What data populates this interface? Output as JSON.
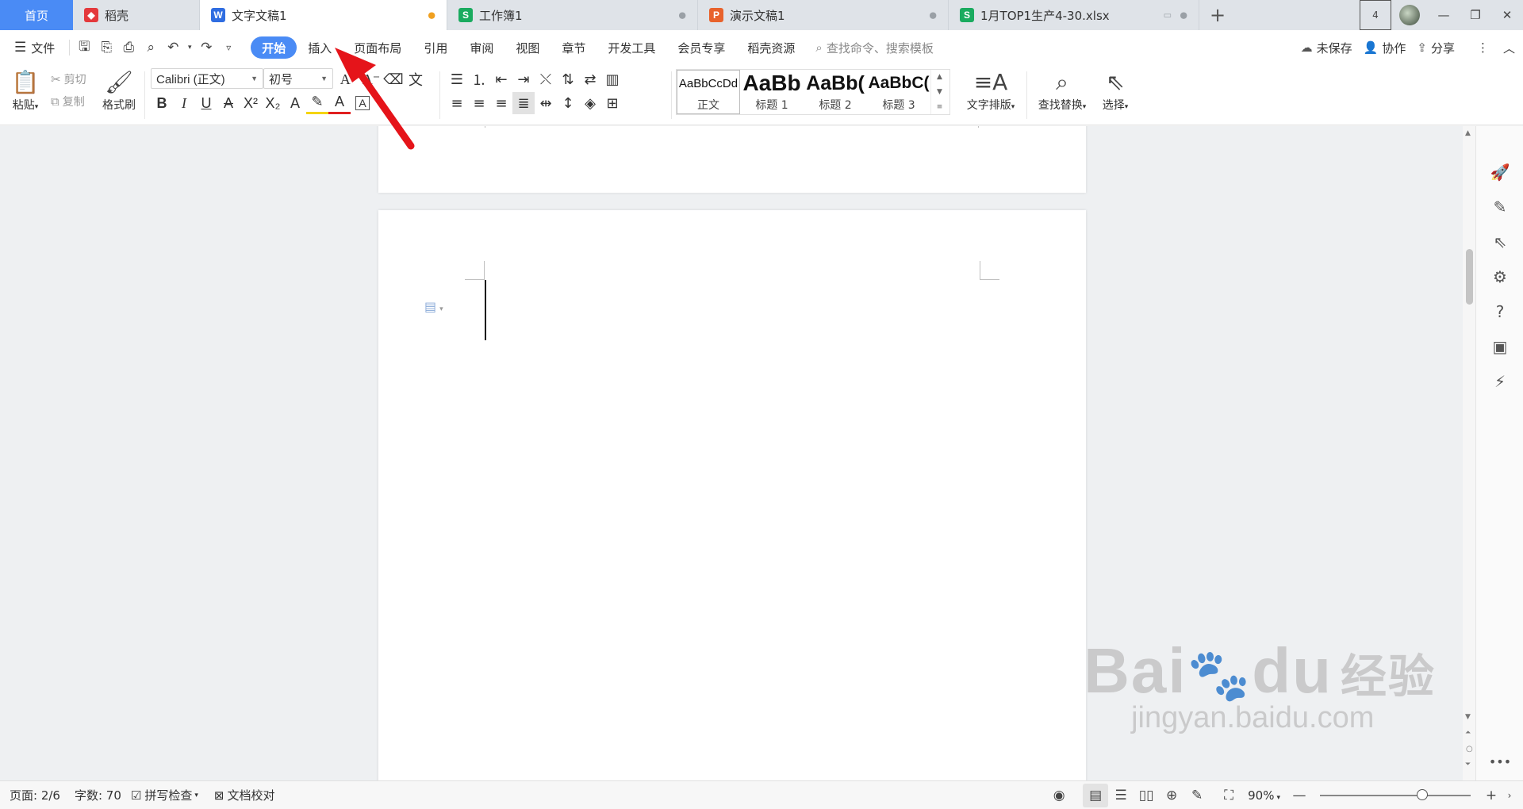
{
  "tabs": [
    {
      "label": "首页",
      "icon": "home-tab"
    },
    {
      "label": "稻壳",
      "icon": "docer-icon",
      "color": "#e4393c"
    },
    {
      "label": "文字文稿1",
      "icon": "writer-icon",
      "color": "#2f6de1",
      "end": "●"
    },
    {
      "label": "工作簿1",
      "icon": "spreadsheet-icon",
      "color": "#1aab5f",
      "end": "●"
    },
    {
      "label": "演示文稿1",
      "icon": "presentation-icon",
      "color": "#e8622c",
      "end": "●"
    },
    {
      "label": "1月TOP1生产4-30.xlsx",
      "icon": "spreadsheet-icon",
      "color": "#1aab5f",
      "end": "●"
    }
  ],
  "window": {
    "badge": "4"
  },
  "menu": {
    "file": "文件",
    "items": [
      "开始",
      "插入",
      "页面布局",
      "引用",
      "审阅",
      "视图",
      "章节",
      "开发工具",
      "会员专享",
      "稻壳资源"
    ],
    "search_placeholder": "查找命令、搜索模板",
    "unsaved": "未保存",
    "collab": "协作",
    "share": "分享"
  },
  "ribbon": {
    "paste": "粘贴",
    "cut": "剪切",
    "copy": "复制",
    "format_painter": "格式刷",
    "font_name": "Calibri (正文)",
    "font_size": "初号",
    "styles": [
      {
        "preview": "AaBbCcDd",
        "name": "正文"
      },
      {
        "preview": "AaBb",
        "name": "标题 1"
      },
      {
        "preview": "AaBb(",
        "name": "标题 2"
      },
      {
        "preview": "AaBbC(",
        "name": "标题 3"
      }
    ],
    "text_layout": "文字排版",
    "find_replace": "查找替换",
    "select": "选择"
  },
  "watermark": {
    "brand": "Bai",
    "brand2": "du",
    "cn": "经验",
    "url": "jingyan.baidu.com"
  },
  "status": {
    "page": "页面: 2/6",
    "words": "字数: 70",
    "spell": "拼写检查",
    "proof": "文档校对",
    "zoom": "90%"
  },
  "colors": {
    "accent": "#4a8bf5",
    "arrow": "#e5141a"
  }
}
